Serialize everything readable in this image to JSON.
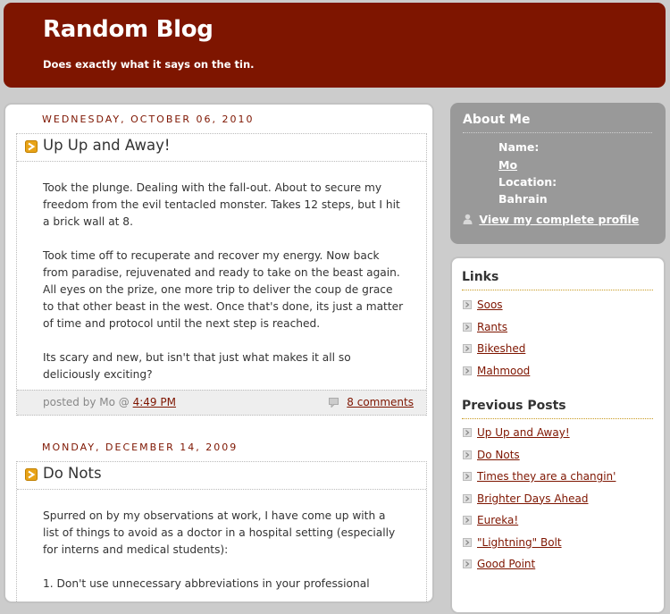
{
  "header": {
    "title": "Random Blog",
    "description": "Does exactly what it says on the tin."
  },
  "posts": [
    {
      "date": "WEDNESDAY, OCTOBER 06, 2010",
      "title": "Up Up and Away!",
      "paragraphs": [
        "Took the plunge. Dealing with the fall-out. About to secure my freedom from the evil tentacled monster. Takes 12 steps, but I hit a brick wall at 8.",
        "Took time off to recuperate and recover my energy. Now back from paradise, rejuvenated and ready to take on the beast again. All eyes on the prize, one more trip to deliver the coup de grace to that other beast in the west. Once that's done, its just a matter of time and protocol until the next step is reached.",
        "Its scary and new, but isn't that just what makes it all so deliciously exciting?"
      ],
      "posted_by": "posted by Mo @",
      "time": "4:49 PM",
      "comments": "8 comments"
    },
    {
      "date": "MONDAY, DECEMBER 14, 2009",
      "title": "Do Nots",
      "paragraphs": [
        "Spurred on by my observations at work, I have come up with a list of things to avoid as a doctor in a hospital setting (especially for interns and medical students):",
        "1. Don't use unnecessary abbreviations in your professional"
      ]
    }
  ],
  "about": {
    "title": "About Me",
    "name_label": "Name:",
    "name": "Mo",
    "location_label": "Location:",
    "location": "Bahrain",
    "profile_link": "View my complete profile"
  },
  "links": {
    "title": "Links",
    "items": [
      "Soos",
      "Rants",
      "Bikeshed",
      "Mahmood"
    ]
  },
  "previous_posts": {
    "title": "Previous Posts",
    "items": [
      "Up Up and Away!",
      "Do Nots",
      "Times they are a changin'",
      "Brighter Days Ahead",
      "Eureka!",
      "\"Lightning\" Bolt",
      "Good Point"
    ]
  },
  "colors": {
    "header_bg": "#7e1500",
    "page_bg": "#cccccc",
    "accent_orange": "#e8a317",
    "sidebar_grey": "#999999"
  }
}
